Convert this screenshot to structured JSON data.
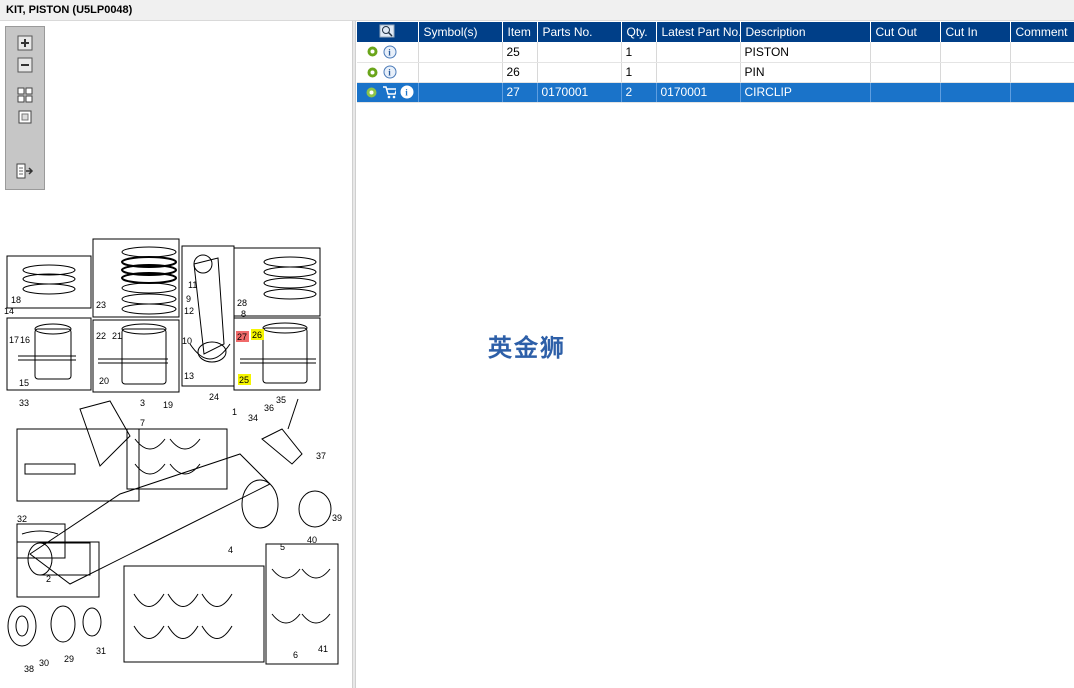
{
  "window": {
    "title": "KIT, PISTON (U5LP0048)"
  },
  "toolbar": {
    "buttons": [
      "zoom-in-icon",
      "zoom-out-icon",
      "fit-all-icon",
      "fit-page-icon",
      "export-icon"
    ]
  },
  "diagram": {
    "callouts": [
      "1",
      "2",
      "3",
      "4",
      "5",
      "6",
      "7",
      "8",
      "9",
      "10",
      "11",
      "12",
      "13",
      "14",
      "15",
      "16",
      "17",
      "18",
      "19",
      "20",
      "21",
      "22",
      "23",
      "24",
      "25",
      "26",
      "27",
      "28",
      "29",
      "30",
      "31",
      "32",
      "33",
      "34",
      "35",
      "36",
      "37",
      "38",
      "39",
      "40",
      "41"
    ],
    "highlighted": {
      "red": [
        "27"
      ],
      "yellow": [
        "25",
        "26"
      ]
    }
  },
  "table": {
    "columns": [
      "Symbol(s)",
      "Item",
      "Parts No.",
      "Qty.",
      "Latest Part No.",
      "Description",
      "Cut Out",
      "Cut In",
      "Comment"
    ],
    "rows": [
      {
        "item": "25",
        "parts_no": "",
        "qty": "1",
        "latest": "",
        "description": "PISTON",
        "cut_out": "",
        "cut_in": "",
        "comment": "",
        "selected": false
      },
      {
        "item": "26",
        "parts_no": "",
        "qty": "1",
        "latest": "",
        "description": "PIN",
        "cut_out": "",
        "cut_in": "",
        "comment": "",
        "selected": false
      },
      {
        "item": "27",
        "parts_no": "0170001",
        "qty": "2",
        "latest": "0170001",
        "description": "CIRCLIP",
        "cut_out": "",
        "cut_in": "",
        "comment": "",
        "selected": true
      }
    ]
  },
  "watermark": "英金狮",
  "colors": {
    "header": "#003f88",
    "selection": "#1a73c9",
    "highlight_red": "#f06a6a",
    "highlight_yellow": "#f5f500"
  }
}
